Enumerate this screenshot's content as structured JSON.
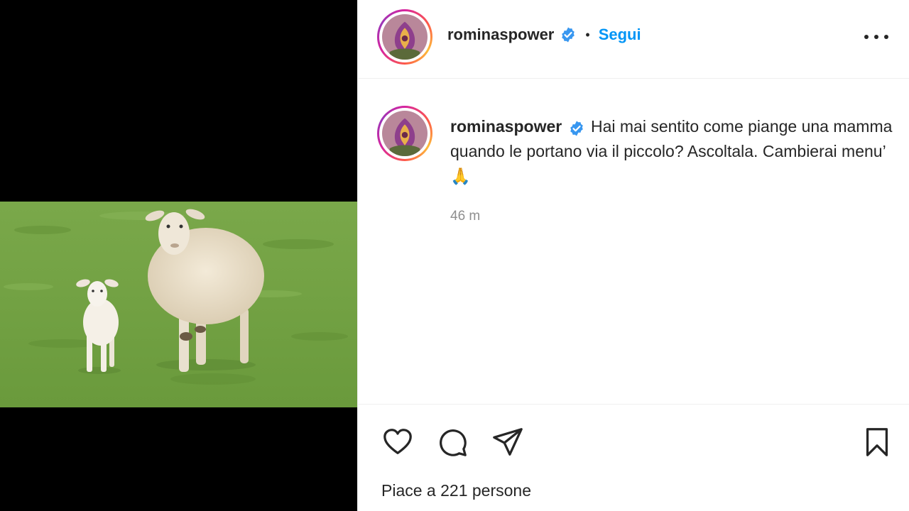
{
  "post": {
    "username": "rominaspower",
    "follow_label": "Segui",
    "dot": "•",
    "caption": "Hai mai sentito come piange una mamma quando le portano via il piccolo? Ascoltala. Cambierai menu’ 🙏",
    "time": "46 m",
    "likes": "Piace a 221 persone"
  },
  "icons": {
    "verified": "verified-badge-icon",
    "more": "more-options-icon",
    "like": "heart-icon",
    "comment": "comment-icon",
    "share": "share-icon",
    "save": "bookmark-icon"
  },
  "colors": {
    "follow": "#0095f6",
    "verified": "#3897f0",
    "muted": "#8e8e8e"
  }
}
